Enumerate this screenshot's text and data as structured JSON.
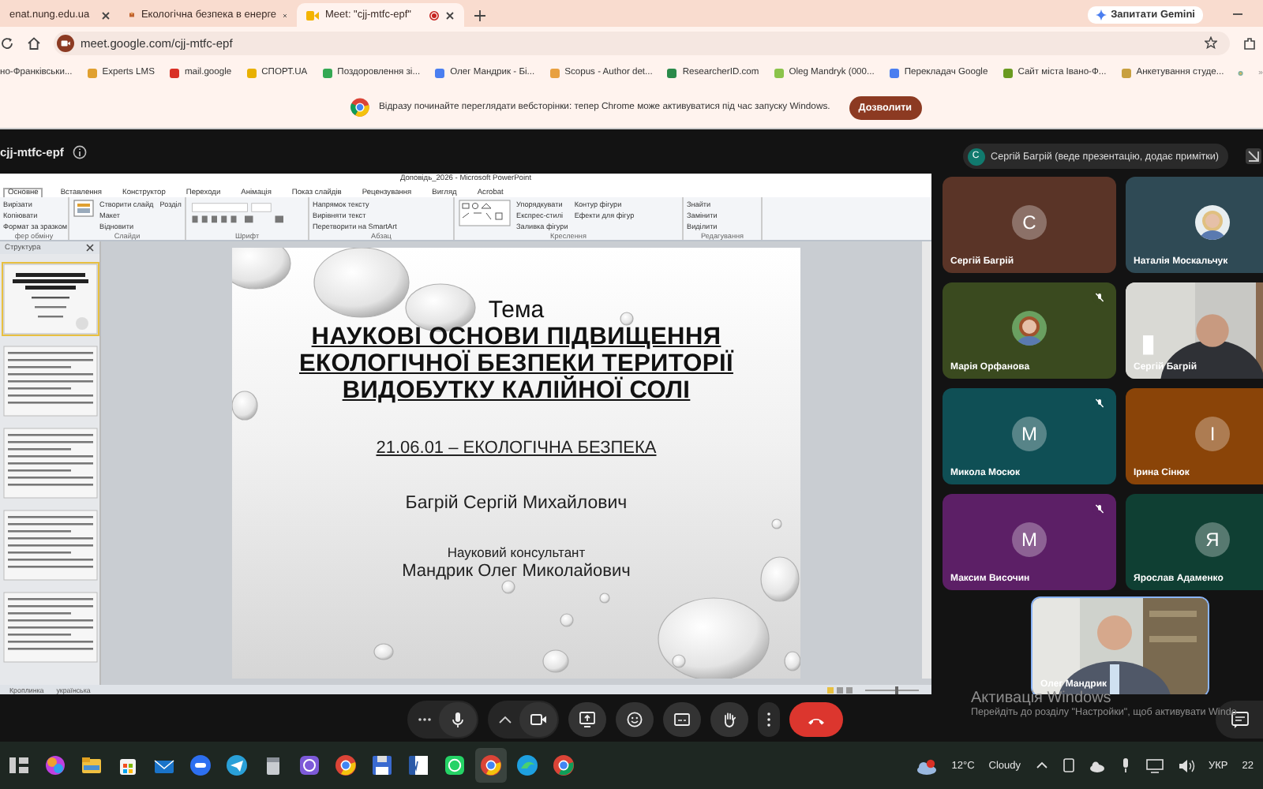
{
  "browser": {
    "tabs": [
      {
        "label": "enat.nung.edu.ua",
        "selected": false,
        "recording": false
      },
      {
        "label": "Екологічна безпека в енерге",
        "selected": false,
        "recording": false
      },
      {
        "label": "Meet: \"cjj-mtfc-epf\"",
        "selected": true,
        "recording": true
      }
    ],
    "gemini_button": "Запитати Gemini",
    "address": "meet.google.com/cjj-mtfc-epf",
    "bookmarks": [
      "но-Франківськи...",
      "Experts LMS",
      "mail.google",
      "СПОРТ.UA",
      "Поздоровлення зі...",
      "Олег Мандрик - Бі...",
      "Scopus - Author det...",
      "ResearcherID.com",
      "Oleg Mandryk (000...",
      "Перекладач Google",
      "Сайт міста Івано-Ф...",
      "Анкетування студе..."
    ],
    "infobar": {
      "message": "Відразу починайте переглядати вебсторінки: тепер Chrome може активуватися під час запуску Windows.",
      "button": "Дозволити"
    }
  },
  "meet": {
    "meeting_code": "cjj-mtfc-epf",
    "presenter": {
      "initial": "С",
      "label": "Сергій Багрій (веде презентацію, додає примітки)"
    },
    "powerpoint": {
      "title": "Доповідь_2026 - Microsoft PowerPoint",
      "ribbon_tabs": [
        {
          "label": "Основне",
          "selected": true
        },
        {
          "label": "Вставлення",
          "selected": false
        },
        {
          "label": "Конструктор",
          "selected": false
        },
        {
          "label": "Переходи",
          "selected": false
        },
        {
          "label": "Анімація",
          "selected": false
        },
        {
          "label": "Показ слайдів",
          "selected": false
        },
        {
          "label": "Рецензування",
          "selected": false
        },
        {
          "label": "Вигляд",
          "selected": false
        },
        {
          "label": "Acrobat",
          "selected": false
        }
      ],
      "ribbon_groups": [
        {
          "label": "фер обміну",
          "buttons": [
            "Вирізати",
            "Копіювати",
            "Формат за зразком"
          ]
        },
        {
          "label": "Слайди",
          "buttons": [
            "Створити слайд",
            "Макет",
            "Відновити",
            "Розділ"
          ]
        },
        {
          "label": "Шрифт"
        },
        {
          "label": "Абзац",
          "buttons": [
            "Напрямок тексту",
            "Вирівняти текст",
            "Перетворити на SmartArt"
          ]
        },
        {
          "label": "Креслення",
          "buttons": [
            "Упорядкувати",
            "Експрес-стилі",
            "Заливка фігури",
            "Контур фігури",
            "Ефекти для фігур"
          ]
        },
        {
          "label": "Редагування",
          "buttons": [
            "Знайти",
            "Замінити",
            "Виділити"
          ]
        }
      ],
      "outline_tab": "Структура",
      "slide_thumbnails": [
        {
          "selected": true
        },
        {
          "selected": false
        },
        {
          "selected": false
        },
        {
          "selected": false
        },
        {
          "selected": false
        }
      ],
      "status": [
        "Кроплинка",
        "українська"
      ],
      "zoom": {
        "level": 0.55
      },
      "slide": {
        "topic": "Тема",
        "title_lines": [
          "НАУКОВІ ОСНОВИ ПІДВИЩЕННЯ",
          "ЕКОЛОГІЧНОЇ БЕЗПЕКИ ТЕРИТОРІЇ",
          "ВИДОБУТКУ КАЛІЙНОЇ СОЛІ"
        ],
        "specialty": "21.06.01 – ЕКОЛОГІЧНА БЕЗПЕКА",
        "author": "Багрій Сергій Михайлович",
        "consultant_label": "Науковий консультант",
        "consultant": "Мандрик Олег Миколайович"
      }
    },
    "participants": [
      {
        "name": "Сергій Багрій",
        "kind": "letter",
        "initial": "С",
        "color": "#5a3427",
        "muted": false
      },
      {
        "name": "Наталія Москальчук",
        "color": "#2f4a55",
        "muted": false
      },
      {
        "name": "Марія Орфанова",
        "color": "#3a4a1f",
        "muted": true
      },
      {
        "name": "Сергій Багрій",
        "kind": "video",
        "muted": false
      },
      {
        "name": "Микола Мосюк",
        "kind": "letter",
        "initial": "М",
        "color": "#0f4f55",
        "muted": true
      },
      {
        "name": "Ірина Сінюк",
        "kind": "letter",
        "initial": "І",
        "color": "#8a4408",
        "muted": false
      },
      {
        "name": "Максим Височин",
        "kind": "letter",
        "initial": "М",
        "color": "#5c1f66",
        "muted": true
      },
      {
        "name": "Ярослав Адаменко",
        "kind": "letter",
        "initial": "Я",
        "color": "#0f3f33",
        "muted": false
      }
    ],
    "self_view": {
      "name": "Олег Мандрик"
    }
  },
  "activation": {
    "title": "Активація Windows",
    "message": "Перейдіть до розділу \"Настройки\", щоб активувати Windo"
  },
  "taskbar": {
    "temperature": "12°C",
    "condition": "Cloudy",
    "language": "УКР",
    "clock": "22"
  }
}
